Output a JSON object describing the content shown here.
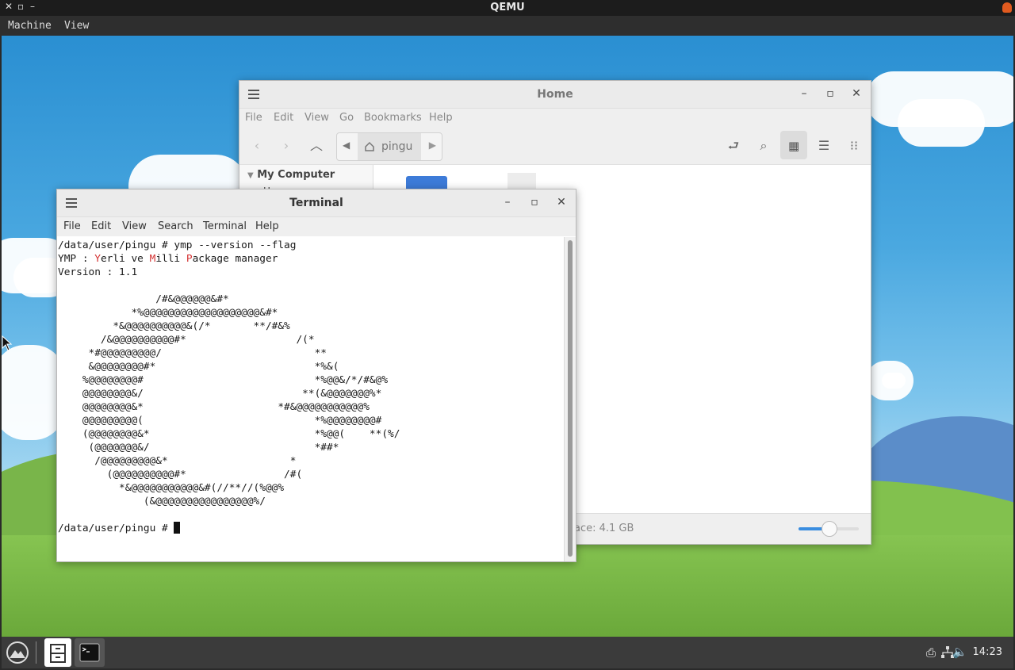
{
  "qemu": {
    "title": "QEMU",
    "menu": [
      "Machine",
      "View"
    ],
    "controls": [
      "✕",
      "▫",
      "–"
    ]
  },
  "file_manager": {
    "title": "Home",
    "menu": [
      "File",
      "Edit",
      "View",
      "Go",
      "Bookmarks",
      "Help"
    ],
    "path": "pingu",
    "sidebar_heading": "My Computer",
    "sidebar_item": "Home",
    "status": "ace: 4.1 GB",
    "zoom_level": 0.5
  },
  "terminal": {
    "title": "Terminal",
    "menu": [
      "File",
      "Edit",
      "View",
      "Search",
      "Terminal",
      "Help"
    ],
    "lines": {
      "cmd": "/data/user/pingu # ymp --version --flag",
      "ymp_a": "YMP : ",
      "ymp_y": "Y",
      "ymp_b": "erli ve ",
      "ymp_m": "M",
      "ymp_c": "illi ",
      "ymp_p": "P",
      "ymp_d": "ackage manager",
      "version": "Version : 1.1",
      "logo": "                /#&@@@@@@&#*\n            *%@@@@@@@@@@@@@@@@@@@&#*\n         *&@@@@@@@@@@&(/*       **/#&%\n       /&@@@@@@@@@@#*                  /(*\n     *#@@@@@@@@@/                         **\n     &@@@@@@@@#*                          *%&(\n    %@@@@@@@@#                            *%@@&/*/#&@%\n    @@@@@@@@&/                          **(&@@@@@@@%*\n    @@@@@@@@&*                      *#&@@@@@@@@@@@%\n    @@@@@@@@@(                            *%@@@@@@@@#\n    (@@@@@@@@&*                           *%@@(    **(%/\n     (@@@@@@@&/                           *##*\n      /@@@@@@@@@&*                    *\n        (@@@@@@@@@@#*                /#(\n          *&@@@@@@@@@@@&#(//**//(%@@%\n              (&@@@@@@@@@@@@@@@@%/",
      "prompt": "/data/user/pingu # "
    }
  },
  "taskbar": {
    "clock": "14:23"
  }
}
